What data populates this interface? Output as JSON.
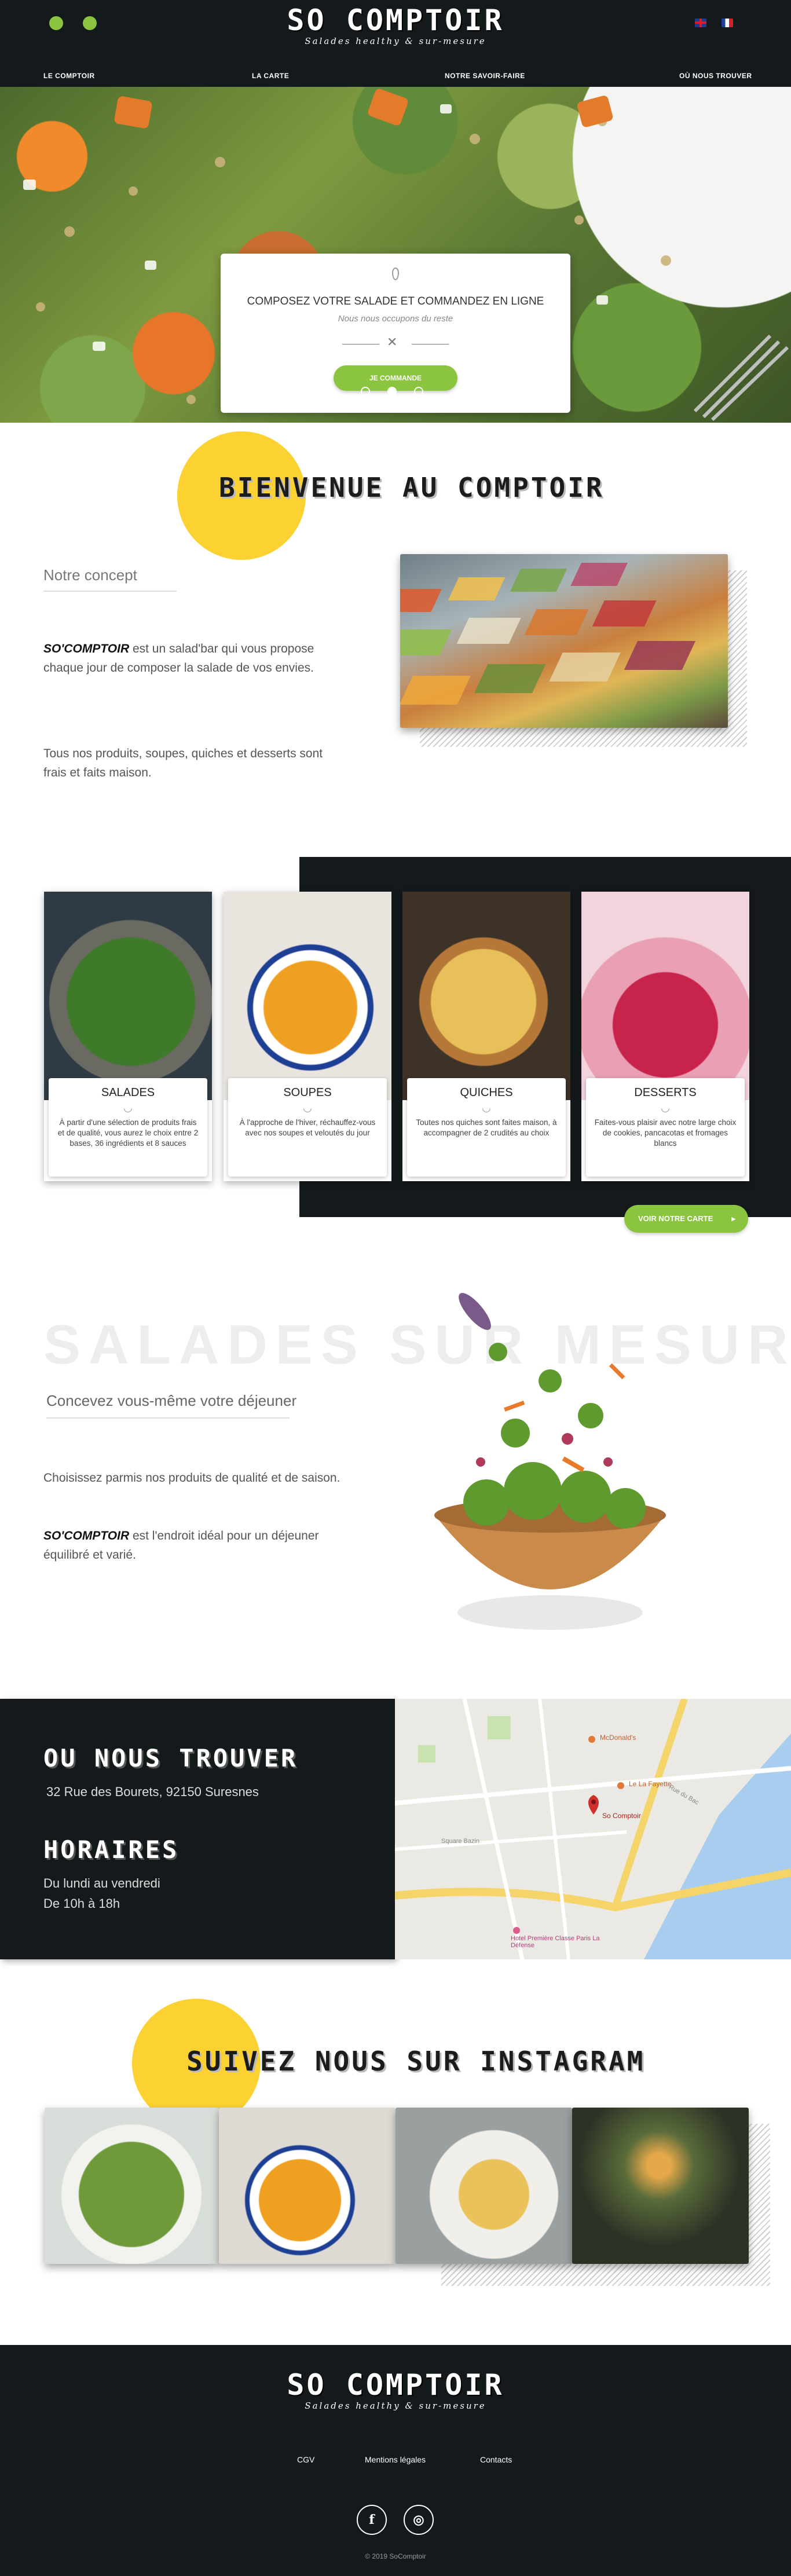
{
  "header": {
    "logo_main": "SO COMPTOIR",
    "logo_sub": "Salades healthy & sur-mesure",
    "nav": [
      "LE COMPTOIR",
      "LA CARTE",
      "NOTRE SAVOIR-FAIRE",
      "OÙ NOUS TROUVER"
    ],
    "languages": [
      "en",
      "fr"
    ]
  },
  "hero": {
    "title": "COMPOSEZ VOTRE SALADE ET COMMANDEZ EN LIGNE",
    "subtitle": "Nous nous occupons du reste",
    "button": "JE COMMANDE",
    "slides": 3,
    "active_slide": 1
  },
  "welcome": {
    "title": "BIENVENUE AU COMPTOIR",
    "concept_title": "Notre concept",
    "brand": "SO'COMPTOIR",
    "para1_rest": " est un salad'bar qui vous propose chaque jour de composer la salade de vos envies.",
    "para2": "Tous nos produits, soupes, quiches et desserts sont frais et faits maison."
  },
  "menu": {
    "cards": [
      {
        "title": "SALADES",
        "icon": "salad-bowl-icon",
        "text": "À partir d'une sélection de produits frais et de qualité, vous aurez le choix entre 2 bases, 36 ingrédients et 8 sauces"
      },
      {
        "title": "SOUPES",
        "icon": "soup-icon",
        "text": "À l'approche de l'hiver, réchauffez-vous avec nos soupes et veloutés du jour"
      },
      {
        "title": "QUICHES",
        "icon": "quiche-icon",
        "text": "Toutes nos quiches sont faites maison, à accompagner de 2 crudités au choix"
      },
      {
        "title": "DESSERTS",
        "icon": "dessert-icon",
        "text": "Faites-vous plaisir avec notre large choix de cookies, pancacotas et fromages blancs"
      }
    ],
    "button": "VOIR NOTRE CARTE"
  },
  "custom": {
    "bg_title": "SALADES SUR MESURE",
    "subtitle": "Concevez vous-même votre déjeuner",
    "para1": "Choisissez parmis nos produits de qualité et de saison.",
    "brand": "SO'COMPTOIR",
    "para2_rest": " est l'endroit idéal pour un déjeuner équilibré et varié."
  },
  "location": {
    "title": "OU NOUS TROUVER",
    "address": "32 Rue des Bourets, 92150 Suresnes",
    "hours_title": "HORAIRES",
    "hours_days": "Du lundi au vendredi",
    "hours_time": "De 10h à 18h",
    "map": {
      "marker": "So Comptoir",
      "labels": [
        "McDonald's",
        "Le La Fayette",
        "Hotel Première Classe Paris La Défense",
        "Rue du Bac",
        "Square Bazin"
      ]
    }
  },
  "instagram": {
    "title": "SUIVEZ NOUS SUR INSTAGRAM"
  },
  "footer": {
    "logo_main": "SO COMPTOIR",
    "logo_sub": "Salades healthy & sur-mesure",
    "links": [
      "CGV",
      "Mentions légales",
      "Contacts"
    ],
    "copyright": "© 2019 SoComptoir"
  },
  "colors": {
    "dark": "#141a1c",
    "accent_green": "#8bc53f",
    "accent_yellow": "#fcd233"
  }
}
